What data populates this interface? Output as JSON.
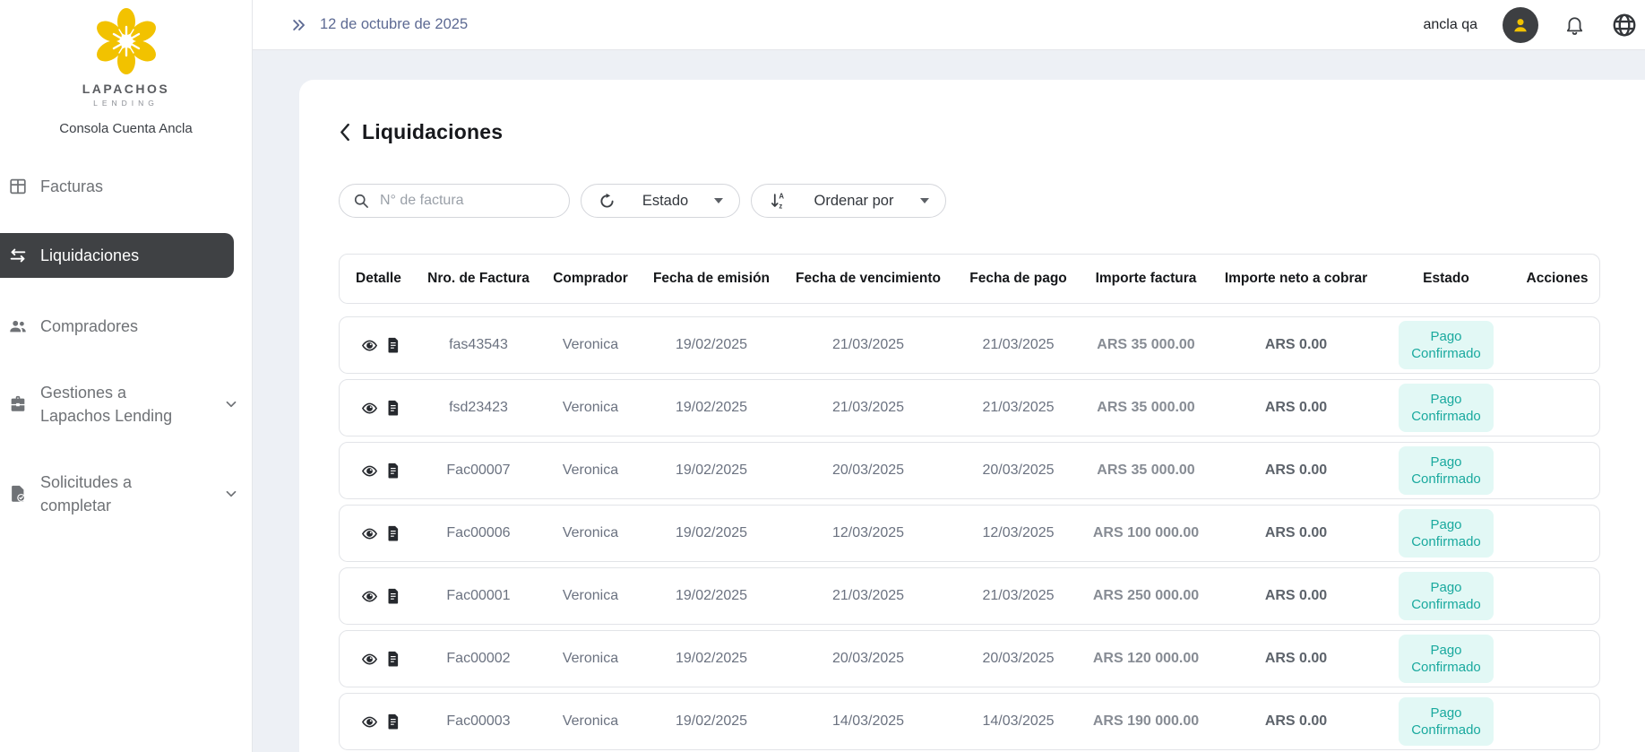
{
  "sidebar": {
    "brand": "LAPACHOS",
    "brand_sub": "LENDING",
    "console_label": "Consola Cuenta Ancla",
    "items": [
      {
        "label": "Facturas",
        "icon": "grid-icon",
        "selected": false,
        "expandable": false
      },
      {
        "label": "Liquidaciones",
        "icon": "swap-arrows-icon",
        "selected": true,
        "expandable": false
      },
      {
        "label": "Compradores",
        "icon": "people-icon",
        "selected": false,
        "expandable": false
      },
      {
        "label": "Gestiones a Lapachos Lending",
        "icon": "briefcase-icon",
        "selected": false,
        "expandable": true
      },
      {
        "label": "Solicitudes a completar",
        "icon": "document-check-icon",
        "selected": false,
        "expandable": true
      }
    ]
  },
  "topbar": {
    "date": "12 de octubre de 2025",
    "user": "ancla qa",
    "icons": [
      "double-chevron-right-icon",
      "avatar-icon",
      "bell-icon",
      "globe-icon"
    ]
  },
  "page": {
    "title": "Liquidaciones",
    "filters": {
      "search_placeholder": "N° de factura",
      "estado_label": "Estado",
      "ordenar_label": "Ordenar por"
    }
  },
  "table": {
    "columns": [
      "Detalle",
      "Nro. de Factura",
      "Comprador",
      "Fecha de emisión",
      "Fecha de vencimiento",
      "Fecha de pago",
      "Importe factura",
      "Importe neto a cobrar",
      "Estado",
      "Acciones"
    ],
    "rows": [
      {
        "invoice": "fas43543",
        "buyer": "Veronica",
        "issued": "19/02/2025",
        "due": "21/03/2025",
        "paid": "21/03/2025",
        "amount": "ARS 35 000.00",
        "net": "ARS 0.00",
        "status": "Pago Confirmado"
      },
      {
        "invoice": "fsd23423",
        "buyer": "Veronica",
        "issued": "19/02/2025",
        "due": "21/03/2025",
        "paid": "21/03/2025",
        "amount": "ARS 35 000.00",
        "net": "ARS 0.00",
        "status": "Pago Confirmado"
      },
      {
        "invoice": "Fac00007",
        "buyer": "Veronica",
        "issued": "19/02/2025",
        "due": "20/03/2025",
        "paid": "20/03/2025",
        "amount": "ARS 35 000.00",
        "net": "ARS 0.00",
        "status": "Pago Confirmado"
      },
      {
        "invoice": "Fac00006",
        "buyer": "Veronica",
        "issued": "19/02/2025",
        "due": "12/03/2025",
        "paid": "12/03/2025",
        "amount": "ARS 100 000.00",
        "net": "ARS 0.00",
        "status": "Pago Confirmado"
      },
      {
        "invoice": "Fac00001",
        "buyer": "Veronica",
        "issued": "19/02/2025",
        "due": "21/03/2025",
        "paid": "21/03/2025",
        "amount": "ARS 250 000.00",
        "net": "ARS 0.00",
        "status": "Pago Confirmado"
      },
      {
        "invoice": "Fac00002",
        "buyer": "Veronica",
        "issued": "19/02/2025",
        "due": "20/03/2025",
        "paid": "20/03/2025",
        "amount": "ARS 120 000.00",
        "net": "ARS 0.00",
        "status": "Pago Confirmado"
      },
      {
        "invoice": "Fac00003",
        "buyer": "Veronica",
        "issued": "19/02/2025",
        "due": "14/03/2025",
        "paid": "14/03/2025",
        "amount": "ARS 190 000.00",
        "net": "ARS 0.00",
        "status": "Pago Confirmado"
      }
    ]
  },
  "colors": {
    "accent_yellow": "#F2C200",
    "selected_item_bg": "#3F4144",
    "status_chip_text": "#19A99E",
    "status_chip_bg": "#E2F8F5",
    "topbar_date_text": "#5D6A93",
    "content_bg": "#EDF0F5"
  }
}
